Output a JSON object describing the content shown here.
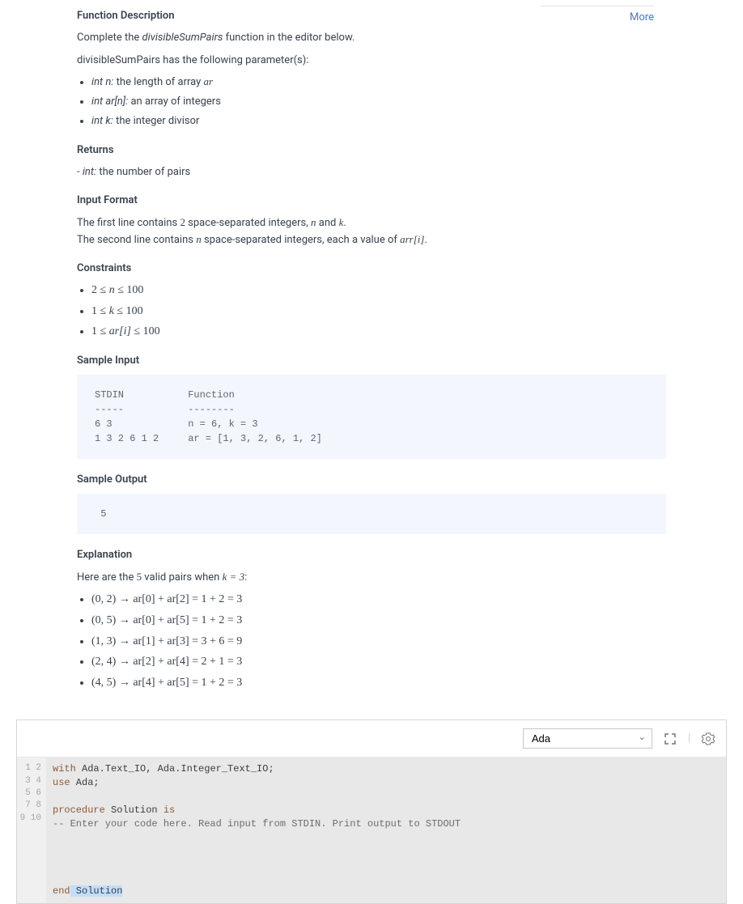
{
  "more_label": "More",
  "h_function_desc": "Function Description",
  "p_complete_prefix": "Complete the ",
  "fn_name": "divisibleSumPairs",
  "p_complete_suffix": " function in the editor below.",
  "p_params_intro": "divisibleSumPairs has the following parameter(s):",
  "params": [
    {
      "sig": "int n:",
      "desc": " the length of array ",
      "math_tail": "ar"
    },
    {
      "sig": "int ar[n]:",
      "desc": " an array of integers",
      "math_tail": ""
    },
    {
      "sig": "int k:",
      "desc": " the integer divisor",
      "math_tail": ""
    }
  ],
  "h_returns": "Returns",
  "returns_sig": "int:",
  "returns_desc": " the number of pairs",
  "h_input_format": "Input Format",
  "input_line1_a": "The first line contains ",
  "input_line1_b": "2",
  "input_line1_c": " space-separated integers, ",
  "input_line1_d": "n",
  "input_line1_e": " and ",
  "input_line1_f": "k",
  "input_line1_g": ".",
  "input_line2_a": "The second line contains ",
  "input_line2_b": "n",
  "input_line2_c": " space-separated integers, each a value of ",
  "input_line2_d": "arr[i]",
  "input_line2_e": ".",
  "h_constraints": "Constraints",
  "constraints": [
    "2 ≤ n ≤ 100",
    "1 ≤ k ≤ 100",
    "1 ≤ ar[i] ≤ 100"
  ],
  "h_sample_input": "Sample Input",
  "sample_input": "STDIN           Function\n-----           --------\n6 3             n = 6, k = 3\n1 3 2 6 1 2     ar = [1, 3, 2, 6, 1, 2]",
  "h_sample_output": "Sample Output",
  "sample_output": " 5",
  "h_explanation": "Explanation",
  "expl_intro_a": "Here are the ",
  "expl_intro_b": "5",
  "expl_intro_c": " valid pairs when ",
  "expl_intro_d": "k = 3",
  "expl_intro_e": ":",
  "expl_items": [
    "(0, 2) → ar[0] + ar[2] = 1 + 2 = 3",
    "(0, 5) → ar[0] + ar[5] = 1 + 2 = 3",
    "(1, 3) → ar[1] + ar[3] = 3 + 6 = 9",
    "(2, 4) → ar[2] + ar[4] = 2 + 1 = 3",
    "(4, 5) → ar[4] + ar[5] = 1 + 2 = 3"
  ],
  "editor": {
    "language": "Ada",
    "line_numbers": [
      "1",
      "2",
      "3",
      "4",
      "5",
      "6",
      "7",
      "8",
      "9",
      "10"
    ],
    "lines": [
      [
        {
          "cls": "kw",
          "t": "with"
        },
        {
          "cls": "",
          "t": " Ada.Text_IO, Ada.Integer_Text_IO;"
        }
      ],
      [
        {
          "cls": "kw",
          "t": "use"
        },
        {
          "cls": "",
          "t": " Ada;"
        }
      ],
      [
        {
          "cls": "",
          "t": ""
        }
      ],
      [
        {
          "cls": "kw",
          "t": "procedure"
        },
        {
          "cls": "",
          "t": " Solution "
        },
        {
          "cls": "kw",
          "t": "is"
        }
      ],
      [
        {
          "cls": "comment",
          "t": "-- Enter your code here. Read input from STDIN. Print output to STDOUT"
        }
      ],
      [
        {
          "cls": "",
          "t": ""
        }
      ],
      [
        {
          "cls": "",
          "t": ""
        }
      ],
      [
        {
          "cls": "",
          "t": ""
        }
      ],
      [
        {
          "cls": "",
          "t": ""
        }
      ],
      [
        {
          "cls": "kw",
          "t": "end"
        },
        {
          "cls": "",
          "t": " Solution"
        }
      ]
    ]
  }
}
